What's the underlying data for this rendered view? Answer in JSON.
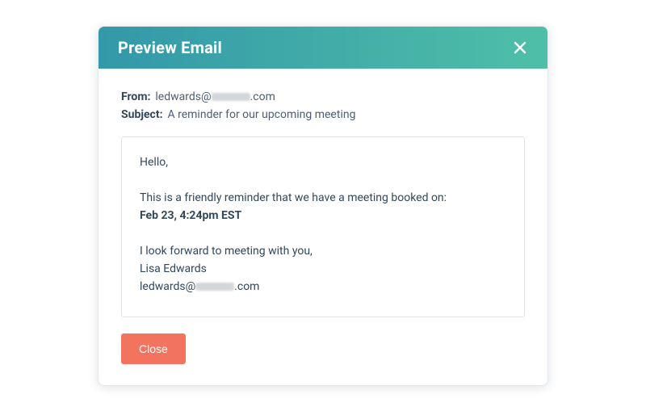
{
  "modal": {
    "title": "Preview Email",
    "close_button_label": "Close"
  },
  "meta": {
    "from_label": "From:",
    "from_value_prefix": "ledwards@",
    "from_value_suffix": ".com",
    "subject_label": "Subject:",
    "subject_value": "A reminder for our upcoming meeting"
  },
  "email": {
    "greeting": "Hello,",
    "reminder_line": "This is a friendly reminder that we have a meeting booked on:",
    "meeting_time": "Feb 23, 4:24pm EST",
    "closing_line": "I look forward to meeting with you,",
    "signature_name": "Lisa Edwards",
    "signature_email_prefix": "ledwards@",
    "signature_email_suffix": ".com"
  }
}
